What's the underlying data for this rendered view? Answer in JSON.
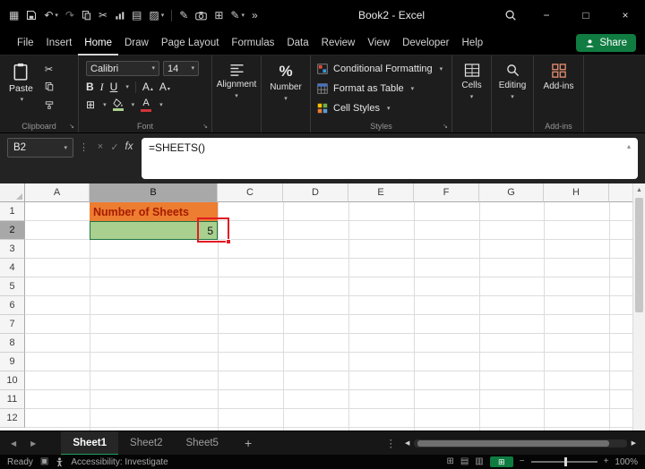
{
  "colors": {
    "accent_green": "#107C41",
    "active_tab_underline": "#1E9C5A",
    "cell_fill_orange": "#ED7D31",
    "cell_text_dark_red": "#A61C00",
    "cell_fill_green": "#A9D08E",
    "annotation_red": "#E31B23",
    "titlebar_bg": "#000000",
    "ribbon_bg": "#1D1D1D",
    "grid_bg": "#FFFFFF"
  },
  "titlebar": {
    "title": "Book2 - Excel"
  },
  "menu": {
    "items": [
      "File",
      "Insert",
      "Home",
      "Draw",
      "Page Layout",
      "Formulas",
      "Data",
      "Review",
      "View",
      "Developer",
      "Help"
    ],
    "active_item": "Home",
    "share_label": "Share"
  },
  "ribbon": {
    "clipboard": {
      "paste_label": "Paste",
      "group_label": "Clipboard"
    },
    "font": {
      "family": "Calibri",
      "size": "14",
      "bold": "B",
      "italic": "I",
      "underline": "U",
      "size_letter": "A",
      "color_letter": "A",
      "group_label": "Font"
    },
    "alignment": {
      "group_label": "Alignment"
    },
    "number": {
      "symbol": "%",
      "group_label": "Number"
    },
    "styles": {
      "conditional_formatting": "Conditional Formatting",
      "format_as_table": "Format as Table",
      "cell_styles": "Cell Styles",
      "group_label": "Styles"
    },
    "cells": {
      "group_label": "Cells"
    },
    "editing": {
      "group_label": "Editing"
    },
    "addins": {
      "button_label": "Add-ins",
      "group_label": "Add-ins"
    }
  },
  "formula_bar": {
    "name_box": "B2",
    "fx_label": "fx",
    "formula": "=SHEETS()"
  },
  "grid": {
    "columns": [
      "A",
      "B",
      "C",
      "D",
      "E",
      "F",
      "G",
      "H"
    ],
    "rows": [
      "1",
      "2",
      "3",
      "4",
      "5",
      "6",
      "7",
      "8",
      "9",
      "10",
      "11",
      "12"
    ],
    "selected_cell": "B2",
    "selected_column": "B",
    "selected_row": "2",
    "cells": {
      "B1": "Number of Sheets",
      "B2": "5"
    }
  },
  "sheet_tabs": {
    "tabs": [
      "Sheet1",
      "Sheet2",
      "Sheet5"
    ],
    "active_tab": "Sheet1"
  },
  "status_bar": {
    "mode": "Ready",
    "accessibility_status": "Accessibility: Investigate",
    "zoom_level": "100%"
  },
  "icons": {
    "apps_grid": "▦",
    "undo": "↶",
    "redo": "↷",
    "cut": "✂",
    "notebook": "▤",
    "shading": "▨",
    "pen": "✎",
    "table_grid": "⊞",
    "overflow": "»",
    "chevron_down": "▾",
    "chevron_up": "▴",
    "ellipsis_vertical": "⋮",
    "cancel": "×",
    "check": "✓",
    "minimize": "−",
    "maximize": "□",
    "close": "×",
    "arrow_left": "◀",
    "arrow_right": "▶",
    "arrow_up": "▲",
    "plus": "+",
    "minus": "−",
    "borders": "⊞",
    "dialog_launcher": "↘",
    "macro": "▣",
    "view_normal": "⊞",
    "view_layout": "▤",
    "view_break": "▥"
  }
}
